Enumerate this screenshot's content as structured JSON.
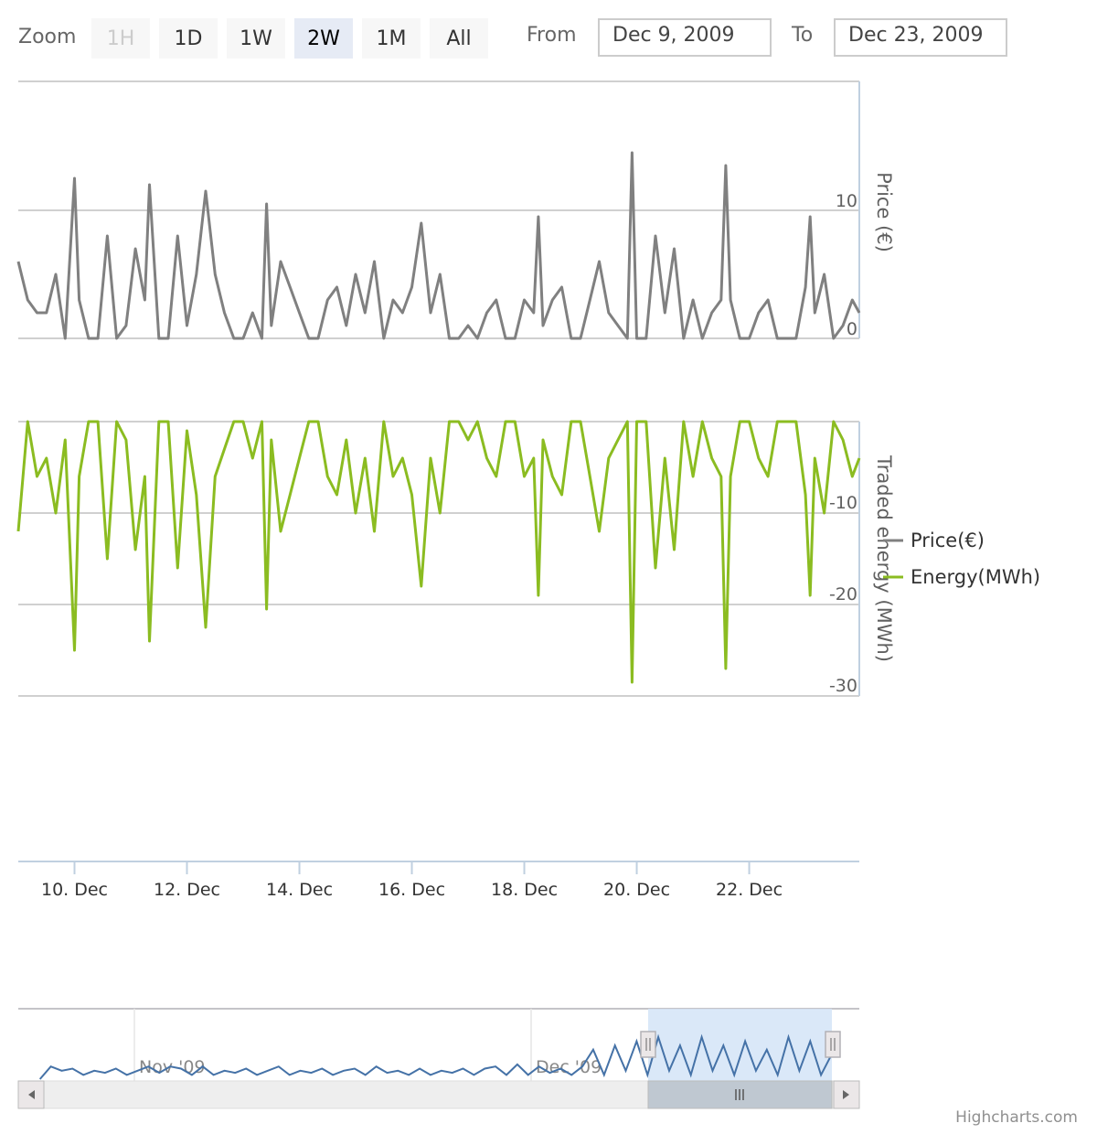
{
  "range_selector": {
    "zoom_label": "Zoom",
    "buttons": [
      {
        "label": "1H",
        "state": "disabled"
      },
      {
        "label": "1D",
        "state": "normal"
      },
      {
        "label": "1W",
        "state": "normal"
      },
      {
        "label": "2W",
        "state": "selected"
      },
      {
        "label": "1M",
        "state": "normal"
      },
      {
        "label": "All",
        "state": "normal"
      }
    ],
    "from_label": "From",
    "from_value": "Dec 9, 2009",
    "to_label": "To",
    "to_value": "Dec 23, 2009"
  },
  "credits": "Highcharts.com",
  "chart_data": {
    "type": "line",
    "x_range": [
      "2009-12-09T00:00",
      "2009-12-23T23:00"
    ],
    "x_ticks": [
      "10. Dec",
      "12. Dec",
      "14. Dec",
      "16. Dec",
      "18. Dec",
      "20. Dec",
      "22. Dec"
    ],
    "legend_position": "right",
    "series": [
      {
        "name": "Price(€)",
        "color": "#808080",
        "axis_title": "Price (€)",
        "ylim": [
          0,
          14
        ],
        "y_ticks": [
          "10",
          "0"
        ],
        "points": [
          [
            "2009-12-09T00:00",
            6
          ],
          [
            "2009-12-09T04:00",
            3
          ],
          [
            "2009-12-09T08:00",
            2
          ],
          [
            "2009-12-09T12:00",
            2
          ],
          [
            "2009-12-09T16:00",
            5
          ],
          [
            "2009-12-09T20:00",
            0
          ],
          [
            "2009-12-10T00:00",
            12.5
          ],
          [
            "2009-12-10T02:00",
            3
          ],
          [
            "2009-12-10T06:00",
            0
          ],
          [
            "2009-12-10T10:00",
            0
          ],
          [
            "2009-12-10T14:00",
            8
          ],
          [
            "2009-12-10T18:00",
            0
          ],
          [
            "2009-12-10T22:00",
            1
          ],
          [
            "2009-12-11T02:00",
            7
          ],
          [
            "2009-12-11T06:00",
            3
          ],
          [
            "2009-12-11T08:00",
            12
          ],
          [
            "2009-12-11T12:00",
            0
          ],
          [
            "2009-12-11T16:00",
            0
          ],
          [
            "2009-12-11T20:00",
            8
          ],
          [
            "2009-12-12T00:00",
            1
          ],
          [
            "2009-12-12T04:00",
            5
          ],
          [
            "2009-12-12T08:00",
            11.5
          ],
          [
            "2009-12-12T12:00",
            5
          ],
          [
            "2009-12-12T16:00",
            2
          ],
          [
            "2009-12-12T20:00",
            0
          ],
          [
            "2009-12-13T00:00",
            0
          ],
          [
            "2009-12-13T04:00",
            2
          ],
          [
            "2009-12-13T08:00",
            0
          ],
          [
            "2009-12-13T10:00",
            10.5
          ],
          [
            "2009-12-13T12:00",
            1
          ],
          [
            "2009-12-13T16:00",
            6
          ],
          [
            "2009-12-13T20:00",
            4
          ],
          [
            "2009-12-14T00:00",
            2
          ],
          [
            "2009-12-14T04:00",
            0
          ],
          [
            "2009-12-14T08:00",
            0
          ],
          [
            "2009-12-14T12:00",
            3
          ],
          [
            "2009-12-14T16:00",
            4
          ],
          [
            "2009-12-14T20:00",
            1
          ],
          [
            "2009-12-15T00:00",
            5
          ],
          [
            "2009-12-15T04:00",
            2
          ],
          [
            "2009-12-15T08:00",
            6
          ],
          [
            "2009-12-15T12:00",
            0
          ],
          [
            "2009-12-15T16:00",
            3
          ],
          [
            "2009-12-15T20:00",
            2
          ],
          [
            "2009-12-16T00:00",
            4
          ],
          [
            "2009-12-16T04:00",
            9
          ],
          [
            "2009-12-16T08:00",
            2
          ],
          [
            "2009-12-16T12:00",
            5
          ],
          [
            "2009-12-16T16:00",
            0
          ],
          [
            "2009-12-16T20:00",
            0
          ],
          [
            "2009-12-17T00:00",
            1
          ],
          [
            "2009-12-17T04:00",
            0
          ],
          [
            "2009-12-17T08:00",
            2
          ],
          [
            "2009-12-17T12:00",
            3
          ],
          [
            "2009-12-17T16:00",
            0
          ],
          [
            "2009-12-17T20:00",
            0
          ],
          [
            "2009-12-18T00:00",
            3
          ],
          [
            "2009-12-18T04:00",
            2
          ],
          [
            "2009-12-18T06:00",
            9.5
          ],
          [
            "2009-12-18T08:00",
            1
          ],
          [
            "2009-12-18T12:00",
            3
          ],
          [
            "2009-12-18T16:00",
            4
          ],
          [
            "2009-12-18T20:00",
            0
          ],
          [
            "2009-12-19T00:00",
            0
          ],
          [
            "2009-12-19T04:00",
            3
          ],
          [
            "2009-12-19T08:00",
            6
          ],
          [
            "2009-12-19T12:00",
            2
          ],
          [
            "2009-12-19T16:00",
            1
          ],
          [
            "2009-12-19T20:00",
            0
          ],
          [
            "2009-12-19T22:00",
            14.5
          ],
          [
            "2009-12-20T00:00",
            0
          ],
          [
            "2009-12-20T04:00",
            0
          ],
          [
            "2009-12-20T08:00",
            8
          ],
          [
            "2009-12-20T12:00",
            2
          ],
          [
            "2009-12-20T16:00",
            7
          ],
          [
            "2009-12-20T20:00",
            0
          ],
          [
            "2009-12-21T00:00",
            3
          ],
          [
            "2009-12-21T04:00",
            0
          ],
          [
            "2009-12-21T08:00",
            2
          ],
          [
            "2009-12-21T12:00",
            3
          ],
          [
            "2009-12-21T14:00",
            13.5
          ],
          [
            "2009-12-21T16:00",
            3
          ],
          [
            "2009-12-21T20:00",
            0
          ],
          [
            "2009-12-22T00:00",
            0
          ],
          [
            "2009-12-22T04:00",
            2
          ],
          [
            "2009-12-22T08:00",
            3
          ],
          [
            "2009-12-22T12:00",
            0
          ],
          [
            "2009-12-22T16:00",
            0
          ],
          [
            "2009-12-22T20:00",
            0
          ],
          [
            "2009-12-23T00:00",
            4
          ],
          [
            "2009-12-23T02:00",
            9.5
          ],
          [
            "2009-12-23T04:00",
            2
          ],
          [
            "2009-12-23T08:00",
            5
          ],
          [
            "2009-12-23T12:00",
            0
          ],
          [
            "2009-12-23T16:00",
            1
          ],
          [
            "2009-12-23T20:00",
            3
          ],
          [
            "2009-12-23T23:00",
            2
          ]
        ]
      },
      {
        "name": "Energy(MWh)",
        "color": "#8bbc21",
        "axis_title": "Traded energy (MWh)",
        "ylim": [
          -30,
          0
        ],
        "y_ticks": [
          "-10",
          "-20",
          "-30"
        ],
        "points": [
          [
            "2009-12-09T00:00",
            -12
          ],
          [
            "2009-12-09T04:00",
            0
          ],
          [
            "2009-12-09T08:00",
            -6
          ],
          [
            "2009-12-09T12:00",
            -4
          ],
          [
            "2009-12-09T16:00",
            -10
          ],
          [
            "2009-12-09T20:00",
            -2
          ],
          [
            "2009-12-10T00:00",
            -25
          ],
          [
            "2009-12-10T02:00",
            -6
          ],
          [
            "2009-12-10T06:00",
            0
          ],
          [
            "2009-12-10T10:00",
            0
          ],
          [
            "2009-12-10T14:00",
            -15
          ],
          [
            "2009-12-10T18:00",
            0
          ],
          [
            "2009-12-10T22:00",
            -2
          ],
          [
            "2009-12-11T02:00",
            -14
          ],
          [
            "2009-12-11T06:00",
            -6
          ],
          [
            "2009-12-11T08:00",
            -24
          ],
          [
            "2009-12-11T12:00",
            0
          ],
          [
            "2009-12-11T16:00",
            0
          ],
          [
            "2009-12-11T20:00",
            -16
          ],
          [
            "2009-12-12T00:00",
            -1
          ],
          [
            "2009-12-12T04:00",
            -8
          ],
          [
            "2009-12-12T08:00",
            -22.5
          ],
          [
            "2009-12-12T12:00",
            -6
          ],
          [
            "2009-12-12T16:00",
            -3
          ],
          [
            "2009-12-12T20:00",
            0
          ],
          [
            "2009-12-13T00:00",
            0
          ],
          [
            "2009-12-13T04:00",
            -4
          ],
          [
            "2009-12-13T08:00",
            0
          ],
          [
            "2009-12-13T10:00",
            -20.5
          ],
          [
            "2009-12-13T12:00",
            -2
          ],
          [
            "2009-12-13T16:00",
            -12
          ],
          [
            "2009-12-13T20:00",
            -8
          ],
          [
            "2009-12-14T00:00",
            -4
          ],
          [
            "2009-12-14T04:00",
            0
          ],
          [
            "2009-12-14T08:00",
            0
          ],
          [
            "2009-12-14T12:00",
            -6
          ],
          [
            "2009-12-14T16:00",
            -8
          ],
          [
            "2009-12-14T20:00",
            -2
          ],
          [
            "2009-12-15T00:00",
            -10
          ],
          [
            "2009-12-15T04:00",
            -4
          ],
          [
            "2009-12-15T08:00",
            -12
          ],
          [
            "2009-12-15T12:00",
            0
          ],
          [
            "2009-12-15T16:00",
            -6
          ],
          [
            "2009-12-15T20:00",
            -4
          ],
          [
            "2009-12-16T00:00",
            -8
          ],
          [
            "2009-12-16T04:00",
            -18
          ],
          [
            "2009-12-16T08:00",
            -4
          ],
          [
            "2009-12-16T12:00",
            -10
          ],
          [
            "2009-12-16T16:00",
            0
          ],
          [
            "2009-12-16T20:00",
            0
          ],
          [
            "2009-12-17T00:00",
            -2
          ],
          [
            "2009-12-17T04:00",
            0
          ],
          [
            "2009-12-17T08:00",
            -4
          ],
          [
            "2009-12-17T12:00",
            -6
          ],
          [
            "2009-12-17T16:00",
            0
          ],
          [
            "2009-12-17T20:00",
            0
          ],
          [
            "2009-12-18T00:00",
            -6
          ],
          [
            "2009-12-18T04:00",
            -4
          ],
          [
            "2009-12-18T06:00",
            -19
          ],
          [
            "2009-12-18T08:00",
            -2
          ],
          [
            "2009-12-18T12:00",
            -6
          ],
          [
            "2009-12-18T16:00",
            -8
          ],
          [
            "2009-12-18T20:00",
            0
          ],
          [
            "2009-12-19T00:00",
            0
          ],
          [
            "2009-12-19T04:00",
            -6
          ],
          [
            "2009-12-19T08:00",
            -12
          ],
          [
            "2009-12-19T12:00",
            -4
          ],
          [
            "2009-12-19T16:00",
            -2
          ],
          [
            "2009-12-19T20:00",
            0
          ],
          [
            "2009-12-19T22:00",
            -28.5
          ],
          [
            "2009-12-20T00:00",
            0
          ],
          [
            "2009-12-20T04:00",
            0
          ],
          [
            "2009-12-20T08:00",
            -16
          ],
          [
            "2009-12-20T12:00",
            -4
          ],
          [
            "2009-12-20T16:00",
            -14
          ],
          [
            "2009-12-20T20:00",
            0
          ],
          [
            "2009-12-21T00:00",
            -6
          ],
          [
            "2009-12-21T04:00",
            0
          ],
          [
            "2009-12-21T08:00",
            -4
          ],
          [
            "2009-12-21T12:00",
            -6
          ],
          [
            "2009-12-21T14:00",
            -27
          ],
          [
            "2009-12-21T16:00",
            -6
          ],
          [
            "2009-12-21T20:00",
            0
          ],
          [
            "2009-12-22T00:00",
            0
          ],
          [
            "2009-12-22T04:00",
            -4
          ],
          [
            "2009-12-22T08:00",
            -6
          ],
          [
            "2009-12-22T12:00",
            0
          ],
          [
            "2009-12-22T16:00",
            0
          ],
          [
            "2009-12-22T20:00",
            0
          ],
          [
            "2009-12-23T00:00",
            -8
          ],
          [
            "2009-12-23T02:00",
            -19
          ],
          [
            "2009-12-23T04:00",
            -4
          ],
          [
            "2009-12-23T08:00",
            -10
          ],
          [
            "2009-12-23T12:00",
            0
          ],
          [
            "2009-12-23T16:00",
            -2
          ],
          [
            "2009-12-23T20:00",
            -6
          ],
          [
            "2009-12-23T23:00",
            -4
          ]
        ]
      }
    ],
    "navigator": {
      "x_labels": [
        "Nov '09",
        "Dec '09"
      ],
      "x_range": [
        "2009-10-10",
        "2009-12-24"
      ],
      "selected_range": [
        "2009-12-09",
        "2009-12-23"
      ],
      "series_color": "#4572a7",
      "ylim": [
        0,
        16
      ],
      "points": [
        [
          "2009-10-12",
          0
        ],
        [
          "2009-10-13",
          3
        ],
        [
          "2009-10-14",
          2
        ],
        [
          "2009-10-15",
          2.5
        ],
        [
          "2009-10-16",
          1
        ],
        [
          "2009-10-17",
          2
        ],
        [
          "2009-10-18",
          1.5
        ],
        [
          "2009-10-19",
          2.5
        ],
        [
          "2009-10-20",
          1
        ],
        [
          "2009-10-21",
          2
        ],
        [
          "2009-10-22",
          3
        ],
        [
          "2009-10-23",
          1.5
        ],
        [
          "2009-10-24",
          3
        ],
        [
          "2009-10-25",
          2.5
        ],
        [
          "2009-10-26",
          1
        ],
        [
          "2009-10-27",
          3
        ],
        [
          "2009-10-28",
          1
        ],
        [
          "2009-10-29",
          2
        ],
        [
          "2009-10-30",
          1.5
        ],
        [
          "2009-10-31",
          2.5
        ],
        [
          "2009-11-01",
          1
        ],
        [
          "2009-11-02",
          2
        ],
        [
          "2009-11-03",
          3
        ],
        [
          "2009-11-04",
          1
        ],
        [
          "2009-11-05",
          2
        ],
        [
          "2009-11-06",
          1.5
        ],
        [
          "2009-11-07",
          2.5
        ],
        [
          "2009-11-08",
          1
        ],
        [
          "2009-11-09",
          2
        ],
        [
          "2009-11-10",
          2.5
        ],
        [
          "2009-11-11",
          1
        ],
        [
          "2009-11-12",
          3
        ],
        [
          "2009-11-13",
          1.5
        ],
        [
          "2009-11-14",
          2
        ],
        [
          "2009-11-15",
          1
        ],
        [
          "2009-11-16",
          2.5
        ],
        [
          "2009-11-17",
          1
        ],
        [
          "2009-11-18",
          2
        ],
        [
          "2009-11-19",
          1.5
        ],
        [
          "2009-11-20",
          2.5
        ],
        [
          "2009-11-21",
          1
        ],
        [
          "2009-11-22",
          2.5
        ],
        [
          "2009-11-23",
          3
        ],
        [
          "2009-11-24",
          1
        ],
        [
          "2009-11-25",
          3.5
        ],
        [
          "2009-11-26",
          1
        ],
        [
          "2009-11-27",
          3
        ],
        [
          "2009-11-28",
          1.5
        ],
        [
          "2009-11-29",
          2.5
        ],
        [
          "2009-11-30",
          1
        ],
        [
          "2009-12-01",
          3
        ],
        [
          "2009-12-02",
          7
        ],
        [
          "2009-12-03",
          1
        ],
        [
          "2009-12-04",
          8
        ],
        [
          "2009-12-05",
          2
        ],
        [
          "2009-12-06",
          9
        ],
        [
          "2009-12-07",
          1
        ],
        [
          "2009-12-08",
          10
        ],
        [
          "2009-12-09",
          2
        ],
        [
          "2009-12-10",
          8
        ],
        [
          "2009-12-11",
          1
        ],
        [
          "2009-12-12",
          10
        ],
        [
          "2009-12-13",
          2
        ],
        [
          "2009-12-14",
          8
        ],
        [
          "2009-12-15",
          1
        ],
        [
          "2009-12-16",
          9
        ],
        [
          "2009-12-17",
          2
        ],
        [
          "2009-12-18",
          7
        ],
        [
          "2009-12-19",
          1
        ],
        [
          "2009-12-20",
          10
        ],
        [
          "2009-12-21",
          2
        ],
        [
          "2009-12-22",
          9
        ],
        [
          "2009-12-23",
          1
        ],
        [
          "2009-12-24",
          6
        ]
      ]
    }
  }
}
